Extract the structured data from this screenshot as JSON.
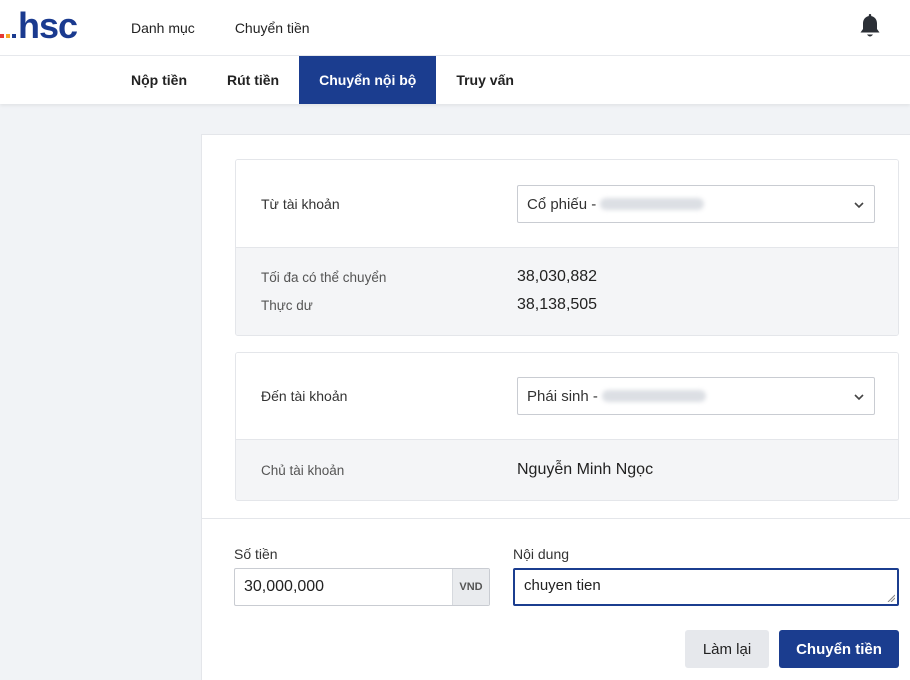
{
  "brand": {
    "logo_text": "hsc",
    "dot_colors": [
      "#e53935",
      "#f5a623",
      "#1a3a8f"
    ]
  },
  "top_nav": {
    "items": [
      {
        "label": "Danh mục"
      },
      {
        "label": "Chuyển tiền"
      }
    ]
  },
  "tabs": [
    {
      "label": "Nộp tiền",
      "active": false
    },
    {
      "label": "Rút tiền",
      "active": false
    },
    {
      "label": "Chuyển nội bộ",
      "active": true
    },
    {
      "label": "Truy vấn",
      "active": false
    }
  ],
  "from_account": {
    "label": "Từ tài khoản",
    "selected": "Cổ phiếu -",
    "max_transfer_label": "Tối đa có thể chuyển",
    "max_transfer_value": "38,030,882",
    "actual_balance_label": "Thực dư",
    "actual_balance_value": "38,138,505"
  },
  "to_account": {
    "label": "Đến tài khoản",
    "selected": "Phái sinh -",
    "owner_label": "Chủ tài khoản",
    "owner_value": "Nguyễn Minh Ngọc"
  },
  "form": {
    "amount_label": "Số tiền",
    "amount_value": "30,000,000",
    "currency": "VND",
    "note_label": "Nội dung",
    "note_value": "chuyen tien"
  },
  "buttons": {
    "reset": "Làm lại",
    "submit": "Chuyển tiền"
  },
  "colors": {
    "primary": "#1b3d8f",
    "muted_bg": "#f4f5f7"
  },
  "icons": {
    "notification": "bell-icon",
    "dropdown": "chevron-down-icon"
  }
}
